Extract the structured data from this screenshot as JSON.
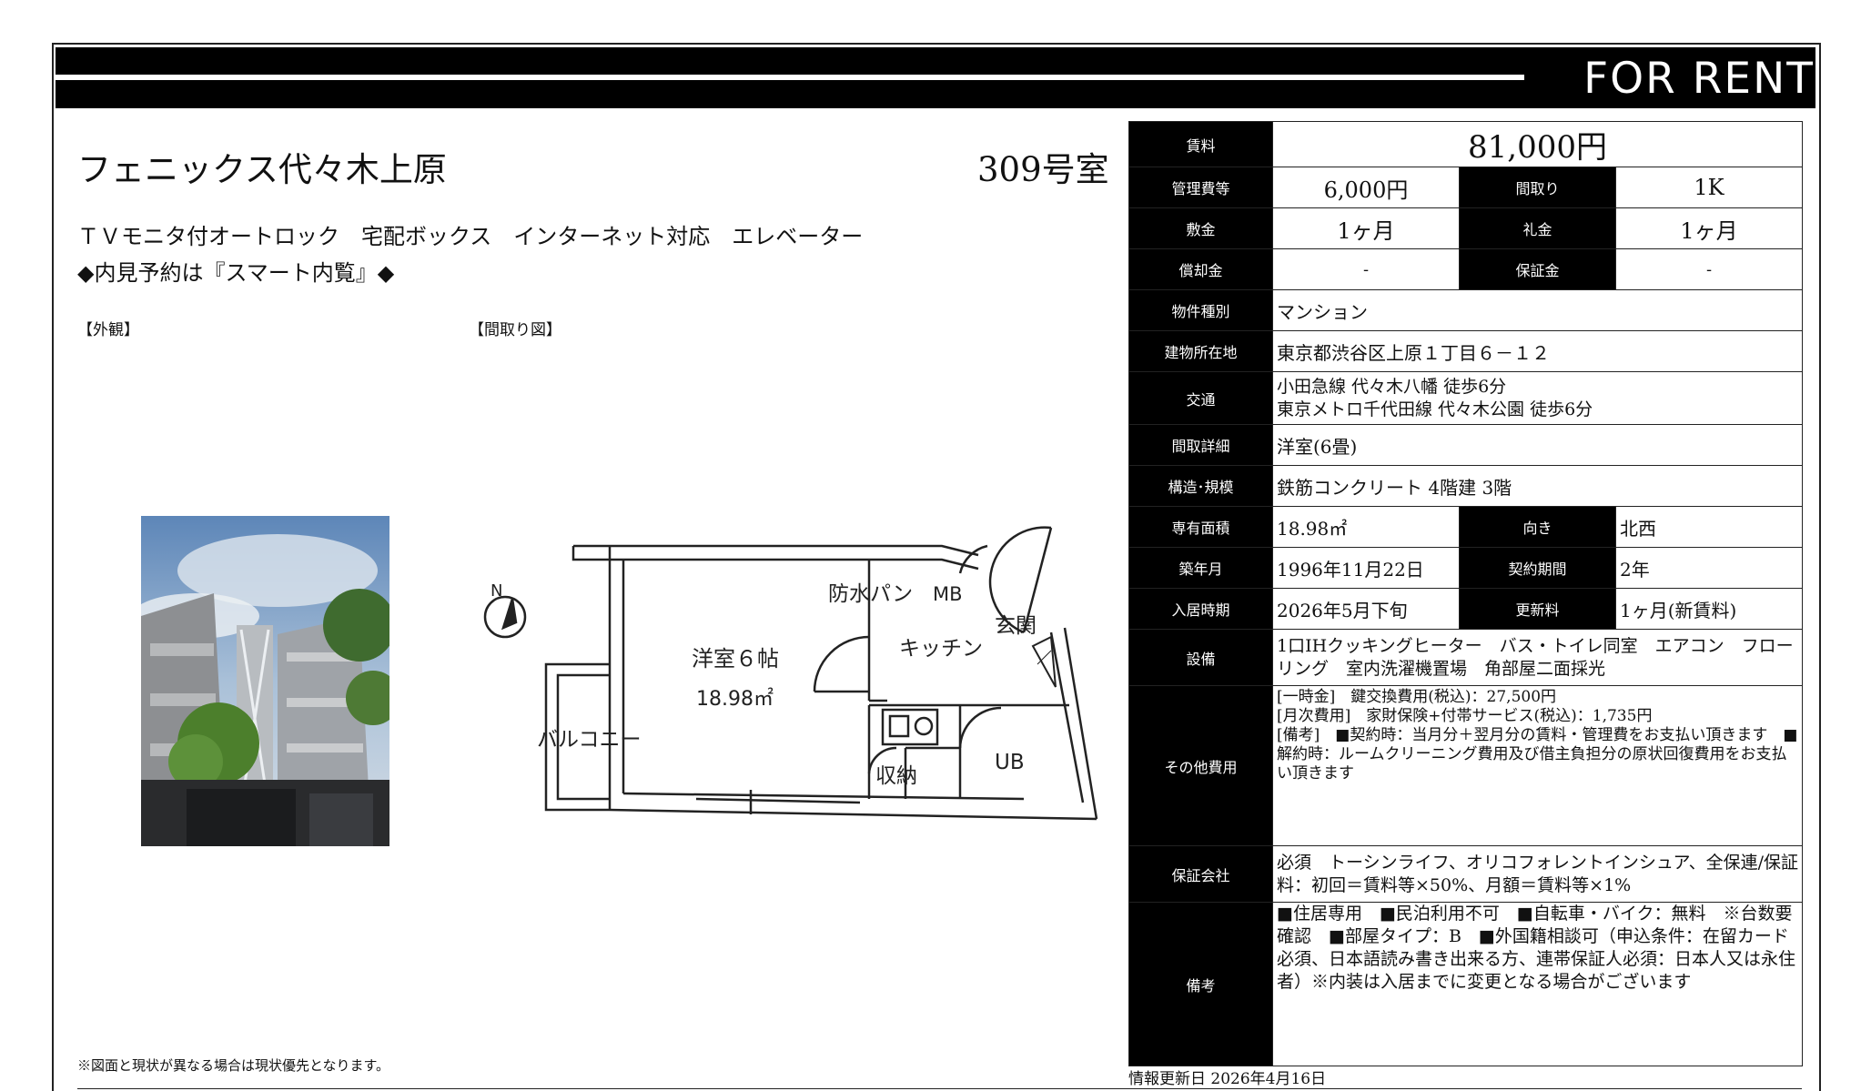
{
  "banner": {
    "text": "FOR RENT"
  },
  "building": {
    "name": "フェニックス代々木上原",
    "room": "309号室",
    "features": "ＴＶモニタ付オートロック　宅配ボックス　インターネット対応　エレベーター",
    "notice": "◆内見予約は『スマート内覧』◆"
  },
  "labels": {
    "exterior": "【外観】",
    "floorplan": "【間取り図】"
  },
  "floorplan_text": {
    "north": "N",
    "western_room": "洋室６帖",
    "area": "18.98㎡",
    "waterproof_pan": "防水パン",
    "mb": "MB",
    "entrance": "玄関",
    "kitchen": "キッチン",
    "balcony": "バルコニー",
    "storage": "収納",
    "ub": "UB"
  },
  "spec": {
    "rent_label": "賃料",
    "rent": "81,000円",
    "mgmt_label": "管理費等",
    "mgmt": "6,000円",
    "layout_label": "間取り",
    "layout": "1K",
    "deposit_label": "敷金",
    "deposit": "1ヶ月",
    "key_money_label": "礼金",
    "key_money": "1ヶ月",
    "amort_label": "償却金",
    "amort": "-",
    "guarantee_label": "保証金",
    "guarantee": "-",
    "type_label": "物件種別",
    "type": "マンション",
    "address_label": "建物所在地",
    "address": "東京都渋谷区上原１丁目６－１２",
    "access_label": "交通",
    "access1": "小田急線 代々木八幡 徒歩6分",
    "access2": "東京メトロ千代田線 代々木公園 徒歩6分",
    "room_detail_label": "間取詳細",
    "room_detail": "洋室(6畳)",
    "structure_label": "構造･規模",
    "structure": "鉄筋コンクリート 4階建 3階",
    "area_label": "専有面積",
    "area": "18.98㎡",
    "direction_label": "向き",
    "direction": "北西",
    "built_label": "築年月",
    "built": "1996年11月22日",
    "term_label": "契約期間",
    "term": "2年",
    "movein_label": "入居時期",
    "movein": "2026年5月下旬",
    "renewal_label": "更新料",
    "renewal": "1ヶ月(新賃料)",
    "facilities_label": "設備",
    "facilities": "1口IHクッキングヒーター　バス・トイレ同室　エアコン　フローリング　室内洗濯機置場　角部屋二面採光",
    "other_costs_label": "その他費用",
    "other_costs": [
      "[一時金]　鍵交換費用(税込)：27,500円",
      "[月次費用]　家財保険+付帯サービス(税込)：1,735円",
      "[備考]　■契約時：当月分＋翌月分の賃料・管理費をお支払い頂きます　■解約時：ルームクリーニング費用及び借主負担分の原状回復費用をお支払い頂きます"
    ],
    "guarantor_label": "保証会社",
    "guarantor": "必須　トーシンライフ、オリコフォレントインシュア、全保連/保証料：初回＝賃料等×50%、月額＝賃料等×1%",
    "remarks_label": "備考",
    "remarks": "■住居専用　■民泊利用不可　■自転車・バイク：無料　※台数要確認　■部屋タイプ：B　■外国籍相談可（申込条件：在留カード必須、日本語読み書き出来る方、連帯保証人必須：日本人又は永住者）※内装は入居までに変更となる場合がございます"
  },
  "footer": {
    "note": "※図面と現状が異なる場合は現状優先となります。",
    "updated": "情報更新日 2026年4月16日"
  }
}
